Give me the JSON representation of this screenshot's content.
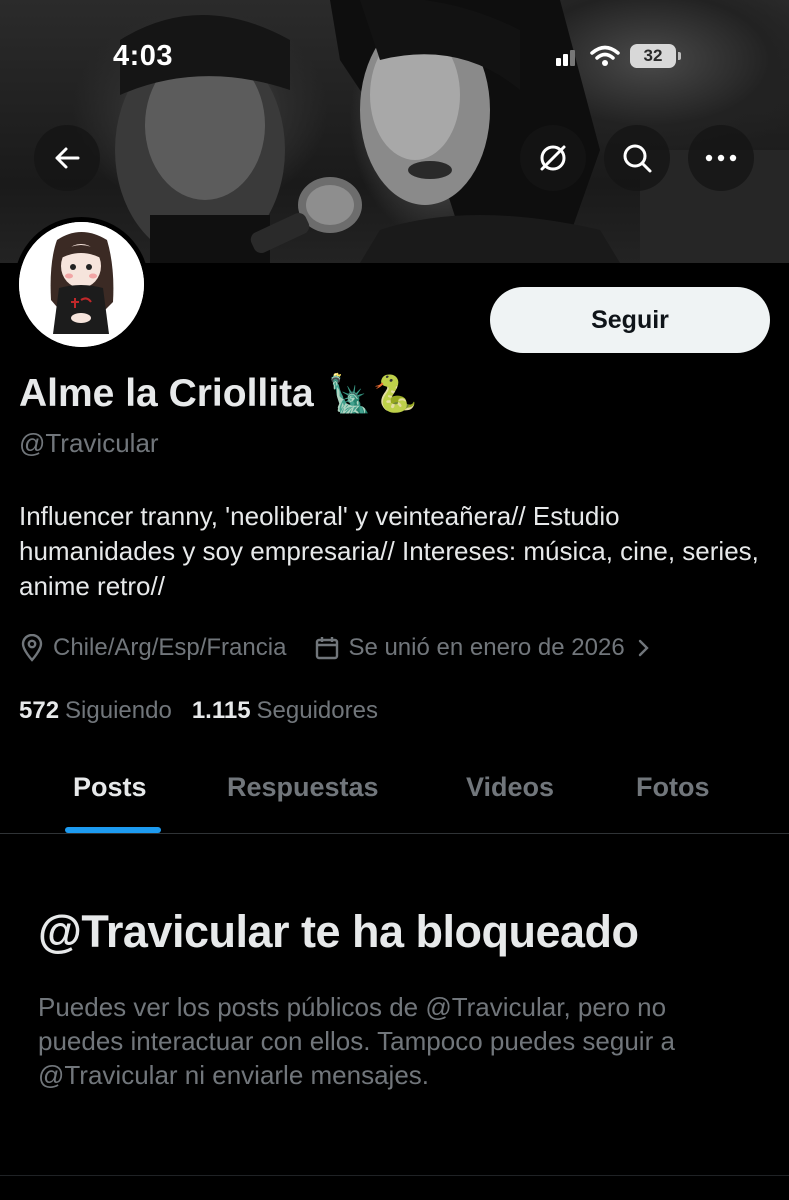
{
  "status_bar": {
    "time": "4:03",
    "battery": "32"
  },
  "header": {
    "icons": [
      "back-arrow-icon",
      "grok-icon",
      "search-icon",
      "more-icon"
    ]
  },
  "profile": {
    "display_name": "Alme la Criollita",
    "name_emojis": "🗽🐍",
    "handle": "@Travicular",
    "follow_label": "Seguir",
    "bio": "Influencer tranny, 'neoliberal' y veinteañera// Estudio humanidades y soy empresaria// Intereses: música, cine, series, anime retro//",
    "location": "Chile/Arg/Esp/Francia",
    "joined": "Se unió en enero de 2026",
    "following_count": "572",
    "following_label": "Siguiendo",
    "followers_count": "1.115",
    "followers_label": "Seguidores"
  },
  "tabs": [
    {
      "label": "Posts",
      "active": true
    },
    {
      "label": "Respuestas",
      "active": false
    },
    {
      "label": "Videos",
      "active": false
    },
    {
      "label": "Fotos",
      "active": false
    }
  ],
  "blocked": {
    "title": "@Travicular te ha bloqueado",
    "description": "Puedes ver los posts públicos de @Travicular, pero no puedes interactuar con ellos. Tampoco puedes seguir a @Travicular ni enviarle mensajes."
  },
  "colors": {
    "accent": "#1d9bf0",
    "secondary_text": "#71767b",
    "primary_text": "#e7e9ea"
  }
}
